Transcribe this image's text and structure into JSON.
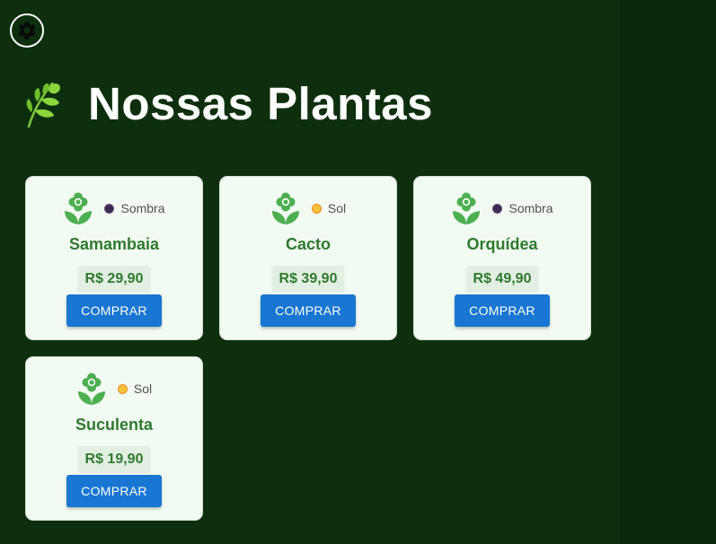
{
  "header": {
    "title": "Nossas Plantas",
    "icon": "leaf-icon"
  },
  "settings": {
    "icon": "gear-icon"
  },
  "colors": {
    "background": "#0d2f0d",
    "card": "#f2fbf2",
    "accent_green": "#2e7a2e",
    "button": "#1976d2",
    "sombra_dot": "#3d2a52",
    "sol_dot": "#f7c23c"
  },
  "plants": [
    {
      "name": "Samambaia",
      "light": "Sombra",
      "light_type": "sombra",
      "price": "R$ 29,90",
      "button_label": "COMPRAR",
      "icon": "flower-icon"
    },
    {
      "name": "Cacto",
      "light": "Sol",
      "light_type": "sol",
      "price": "R$ 39,90",
      "button_label": "COMPRAR",
      "icon": "flower-icon"
    },
    {
      "name": "Orquídea",
      "light": "Sombra",
      "light_type": "sombra",
      "price": "R$ 49,90",
      "button_label": "COMPRAR",
      "icon": "flower-icon"
    },
    {
      "name": "Suculenta",
      "light": "Sol",
      "light_type": "sol",
      "price": "R$ 19,90",
      "button_label": "COMPRAR",
      "icon": "flower-icon"
    }
  ]
}
